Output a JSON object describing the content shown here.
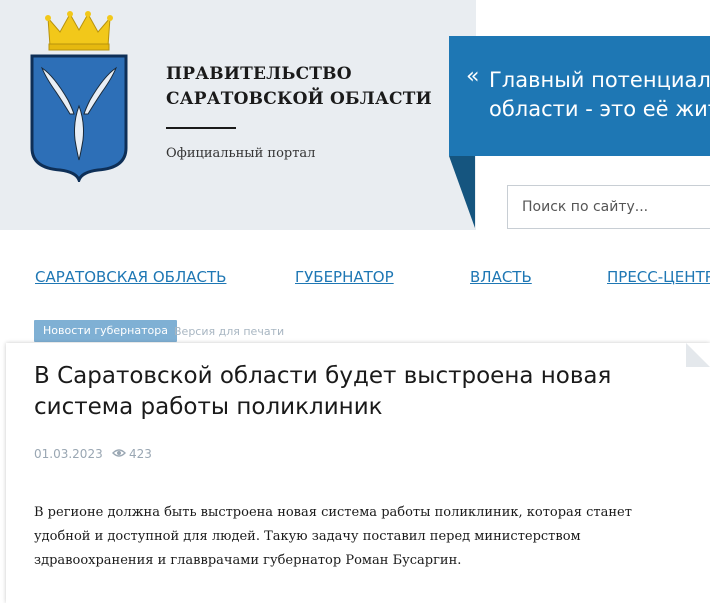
{
  "header": {
    "title_line1": "ПРАВИТЕЛЬСТВО",
    "title_line2": "САРАТОВСКОЙ ОБЛАСТИ",
    "subtitle": "Официальный портал"
  },
  "quote": {
    "mark": "«",
    "line1": "Главный потенциал",
    "line2": "области - это её жит"
  },
  "search": {
    "placeholder": "Поиск по сайту..."
  },
  "nav": {
    "items": [
      {
        "label": "САРАТОВСКАЯ ОБЛАСТЬ"
      },
      {
        "label": "ГУБЕРНАТОР"
      },
      {
        "label": "ВЛАСТЬ"
      },
      {
        "label": "ПРЕСС-ЦЕНТР"
      }
    ]
  },
  "tabs": {
    "active": "Новости губернатора",
    "print": "Версия для печати"
  },
  "article": {
    "title": "В Саратовской области будет выстроена новая система работы поликлиник",
    "date": "01.03.2023",
    "views": "423",
    "body": "В регионе должна быть выстроена новая система работы поликлиник, которая станет удобной и доступной для людей. Такую задачу поставил перед министерством здравоохранения и главврачами губернатор Роман Бусаргин."
  },
  "icons": {
    "coat_of_arms": "coat-of-arms-icon",
    "views": "eye-icon"
  },
  "colors": {
    "accent": "#1e77b4",
    "accent_dark": "#15557f",
    "shield": "#2d6fb7",
    "crown": "#f2c81a",
    "tab": "#7fb0d4",
    "muted": "#9aa7b3"
  }
}
